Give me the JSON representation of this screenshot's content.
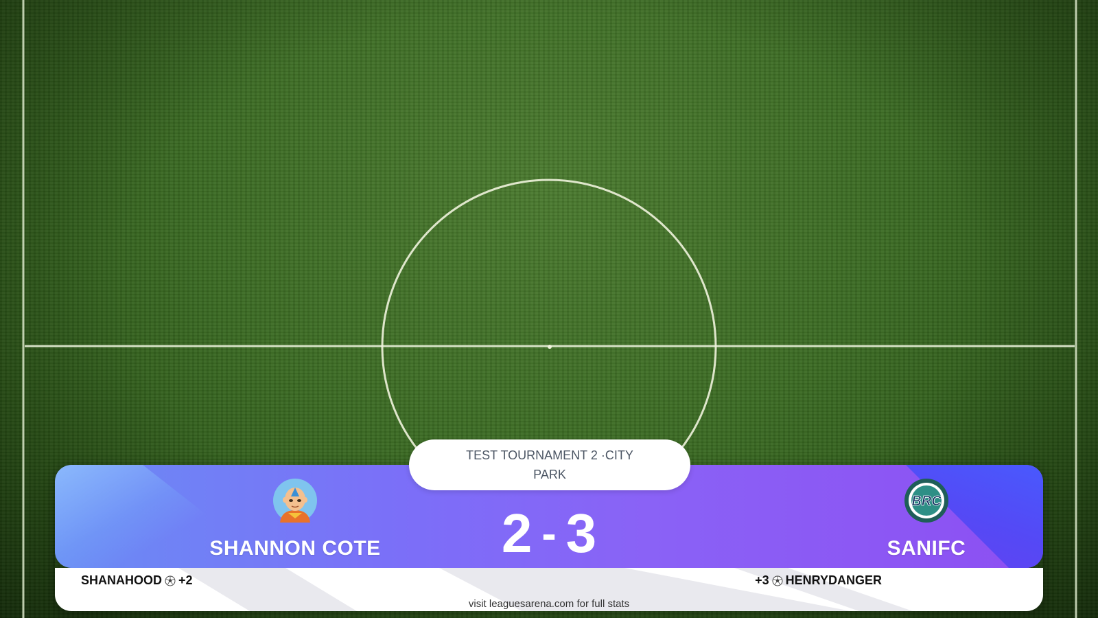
{
  "tournament": {
    "name": "TEST TOURNAMENT 2",
    "separator": "·",
    "venue": "CITY PARK",
    "label": "TEST TOURNAMENT 2 ·CITY PARK"
  },
  "home_team": {
    "name": "SHANNON COTE",
    "score": "2",
    "logo_icon": "avatar-cartoon-monk-icon",
    "scorer": {
      "name": "SHANAHOOD",
      "goals": "+2"
    }
  },
  "away_team": {
    "name": "SANIFC",
    "score": "3",
    "logo_icon": "brc-club-crest-icon",
    "logo_text": "BRC",
    "scorer": {
      "name": "HENRYDANGER",
      "goals": "+3"
    }
  },
  "score_separator": "-",
  "footer": {
    "text": "visit leaguesarena.com for full stats"
  },
  "colors": {
    "banner_start": "#6a8cf4",
    "banner_mid": "#7b6ff8",
    "banner_end": "#8d4ff2",
    "accent_blue": "#3d5bff",
    "pitch": "#3a6a22",
    "text_white": "#ffffff"
  }
}
